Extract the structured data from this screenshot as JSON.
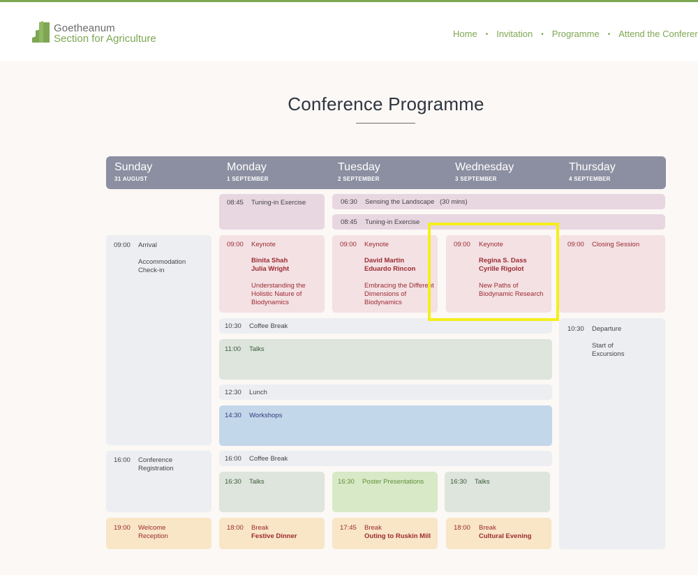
{
  "header": {
    "logo_line1": "Goetheanum",
    "logo_line2": "Section for Agriculture",
    "nav": [
      "Home",
      "Invitation",
      "Programme",
      "Attend the Conferer"
    ]
  },
  "page": {
    "title": "Conference Programme"
  },
  "days": [
    {
      "name": "Sunday",
      "date": "31 AUGUST"
    },
    {
      "name": "Monday",
      "date": "1 SEPTEMBER"
    },
    {
      "name": "Tuesday",
      "date": "2 SEPTEMBER"
    },
    {
      "name": "Wednesday",
      "date": "3 SEPTEMBER"
    },
    {
      "name": "Thursday",
      "date": "4 SEPTEMBER"
    }
  ],
  "events": {
    "mon_tuning": {
      "time": "08:45",
      "title": "Tuning-in Exercise"
    },
    "sensing": {
      "time": "06:30",
      "title": "Sensing the Landscape",
      "note": "(30 mins)"
    },
    "tue_tuning": {
      "time": "08:45",
      "title": "Tuning-in Exercise"
    },
    "sun_arrival": {
      "time": "09:00",
      "title": "Arrival",
      "line1": "Accommodation",
      "line2": "Check-in"
    },
    "mon_keynote": {
      "time": "09:00",
      "title": "Keynote",
      "sp1": "Binita Shah",
      "sp2": "Julia Wright",
      "d1": "Understanding the",
      "d2": "Holistic Nature of",
      "d3": "Biodynamics"
    },
    "tue_keynote": {
      "time": "09:00",
      "title": "Keynote",
      "sp1": "David Martin",
      "sp2": "Eduardo Rincon",
      "d1": "Embracing the Different",
      "d2": "Dimensions of",
      "d3": "Biodynamics"
    },
    "wed_keynote": {
      "time": "09:00",
      "title": "Keynote",
      "sp1": "Regina S. Dass",
      "sp2": "Cyrille Rigolot",
      "d1": "New Paths of",
      "d2": "Biodynamic Research"
    },
    "thu_closing": {
      "time": "09:00",
      "title": "Closing Session"
    },
    "coffee1": {
      "time": "10:30",
      "title": "Coffee Break"
    },
    "thu_departure": {
      "time": "10:30",
      "title": "Departure",
      "line1": "Start of",
      "line2": "Excursions"
    },
    "talks1": {
      "time": "11:00",
      "title": "Talks"
    },
    "lunch": {
      "time": "12:30",
      "title": "Lunch"
    },
    "workshops": {
      "time": "14:30",
      "title": "Workshops"
    },
    "sun_registration": {
      "time": "16:00",
      "title": "Conference",
      "title2": "Registration"
    },
    "coffee2": {
      "time": "16:00",
      "title": "Coffee Break"
    },
    "mon_talks": {
      "time": "16:30",
      "title": "Talks"
    },
    "tue_poster": {
      "time": "16:30",
      "title": "Poster Presentations"
    },
    "wed_talks": {
      "time": "16:30",
      "title": "Talks"
    },
    "sun_welcome": {
      "time": "19:00",
      "title": "Welcome",
      "title2": "Reception"
    },
    "mon_dinner": {
      "time": "18:00",
      "label": "Break",
      "title": "Festive Dinner"
    },
    "tue_outing": {
      "time": "17:45",
      "label": "Break",
      "title": "Outing to Ruskin Mill"
    },
    "wed_evening": {
      "time": "18:00",
      "label": "Break",
      "title": "Cultural Evening"
    }
  }
}
